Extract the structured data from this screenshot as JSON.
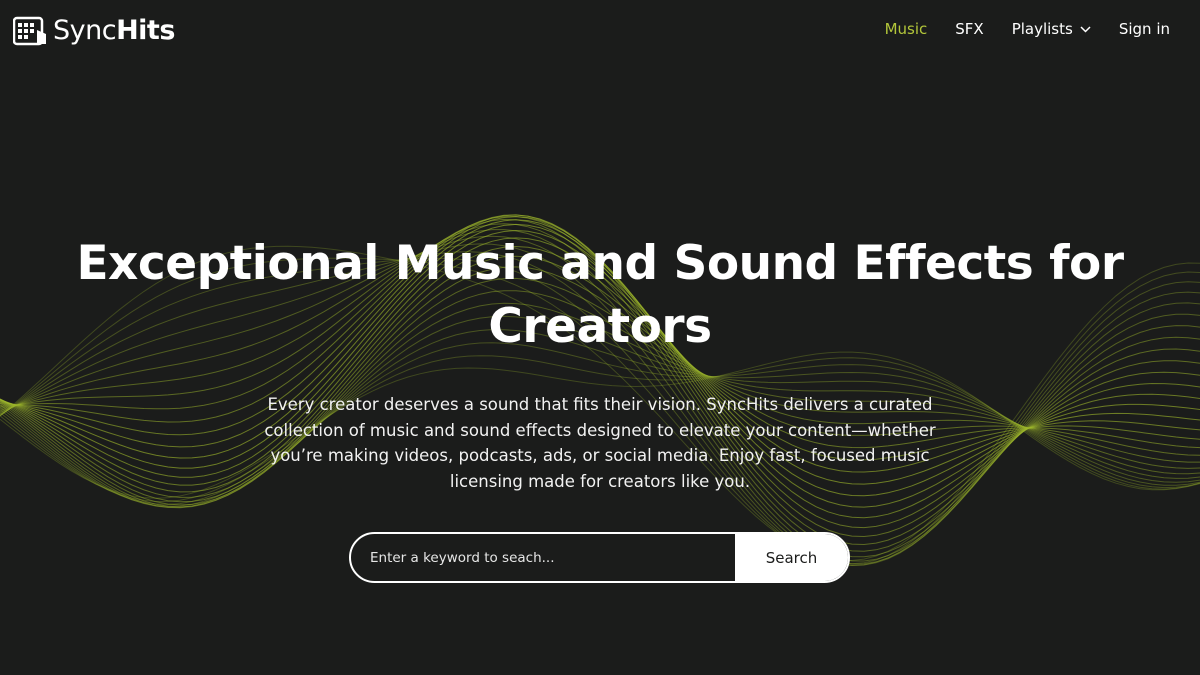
{
  "brand": {
    "name_light": "Sync",
    "name_bold": "Hits",
    "icon": "syncHits-logo-icon"
  },
  "nav": {
    "items": [
      {
        "label": "Music",
        "active": true
      },
      {
        "label": "SFX",
        "active": false
      },
      {
        "label": "Playlists",
        "active": false,
        "icon": "chevron-down-icon"
      },
      {
        "label": "Sign in",
        "active": false
      }
    ]
  },
  "hero": {
    "title_line1": "Exceptional Music and Sound Effects for",
    "title_line2": "Creators",
    "description_line1": "Every creator deserves a sound that fits their vision. SyncHits delivers a curated",
    "description_line2": "collection of music and sound effects designed to elevate your content—whether",
    "description_line3": "you’re making videos, podcasts, ads, or social media. Enjoy fast, focused music",
    "description_line4": "licensing made for creators like you."
  },
  "search": {
    "placeholder": "Enter a keyword to seach...",
    "value": "",
    "button_label": "Search"
  },
  "colors": {
    "background": "#1b1c1b",
    "accent": "#b3c63a",
    "wave": "#9fb92c",
    "text": "#ffffff"
  }
}
